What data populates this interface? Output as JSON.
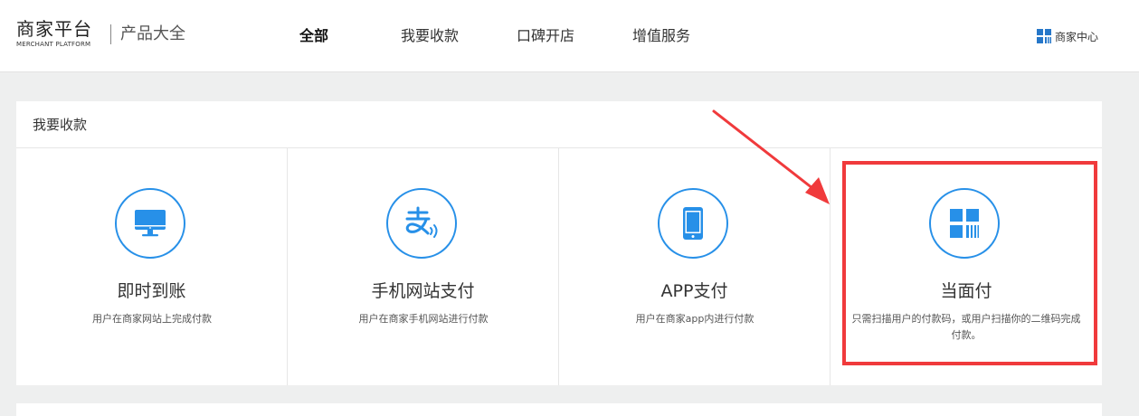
{
  "header": {
    "logo_main": "商家平台",
    "logo_sub": "MERCHANT PLATFORM",
    "product_title": "产品大全",
    "nav": [
      {
        "label": "全部",
        "active": true
      },
      {
        "label": "我要收款",
        "active": false
      },
      {
        "label": "口碑开店",
        "active": false
      },
      {
        "label": "增值服务",
        "active": false
      }
    ],
    "merchant_center": {
      "label": "商家中心",
      "icon": "grid-icon"
    }
  },
  "section": {
    "title": "我要收款",
    "products": [
      {
        "title": "即时到账",
        "desc": "用户在商家网站上完成付款",
        "icon": "monitor-icon"
      },
      {
        "title": "手机网站支付",
        "desc": "用户在商家手机网站进行付款",
        "icon": "alipay-wave-icon"
      },
      {
        "title": "APP支付",
        "desc": "用户在商家app内进行付款",
        "icon": "phone-icon"
      },
      {
        "title": "当面付",
        "desc": "只需扫描用户的付款码，或用户扫描你的二维码完成付款。",
        "icon": "qr-barcode-icon"
      }
    ]
  },
  "colors": {
    "accent_blue": "#2790e8",
    "annotation_red": "#f03a3c",
    "page_bg": "#eeefef"
  }
}
